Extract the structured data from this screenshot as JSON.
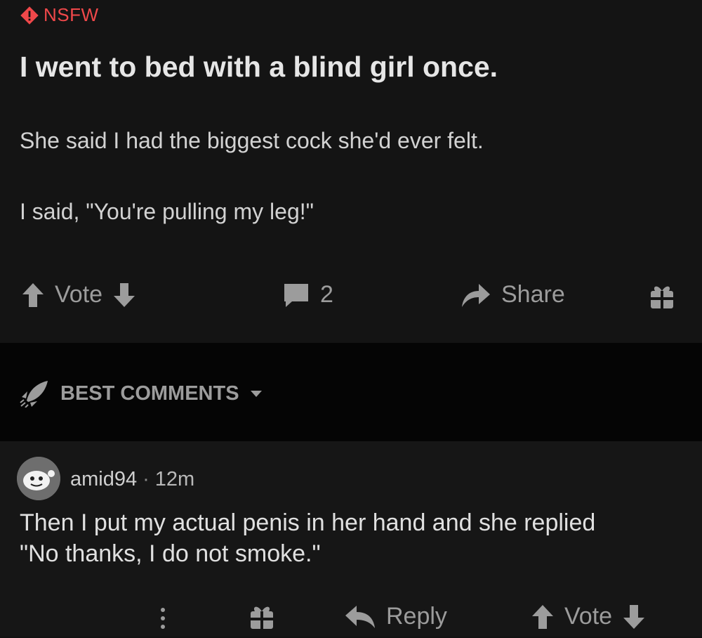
{
  "post": {
    "nsfw_label": "NSFW",
    "title": "I went to bed with a blind girl once.",
    "paragraphs": [
      "She said I had the biggest cock she'd ever felt.",
      "I said, \"You're pulling my leg!\""
    ],
    "actions": {
      "vote_label": "Vote",
      "comment_count": "2",
      "share_label": "Share"
    }
  },
  "sort": {
    "label": "BEST COMMENTS"
  },
  "comment": {
    "author": "amid94",
    "separator": "·",
    "time": "12m",
    "lines": [
      "Then I put my actual penis in her hand and she replied",
      "\"No thanks, I do not smoke.\""
    ],
    "actions": {
      "reply_label": "Reply",
      "vote_label": "Vote"
    }
  },
  "colors": {
    "background": "#121212",
    "nsfw_accent": "#f0484a",
    "muted_text": "#9c9c9c"
  },
  "icons": [
    "nsfw-icon",
    "upvote-icon",
    "downvote-icon",
    "comment-icon",
    "share-icon",
    "gift-icon",
    "rocket-icon",
    "chevron-down-icon",
    "more-icon",
    "reply-icon"
  ]
}
